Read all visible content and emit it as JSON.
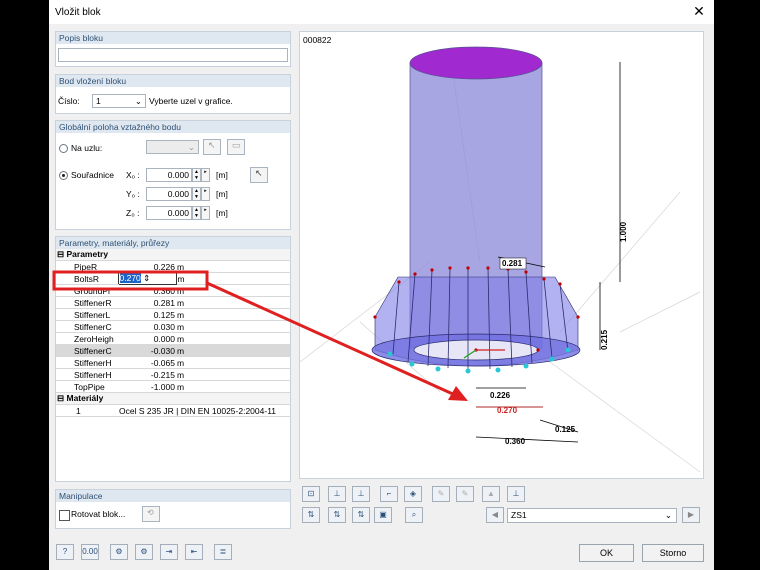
{
  "window": {
    "title": "Vložit blok"
  },
  "description_group": {
    "header": "Popis bloku",
    "value": ""
  },
  "insertion_group": {
    "header": "Bod vložení bloku",
    "number_label": "Číslo:",
    "number_value": "1",
    "hint": "Vyberte uzel v grafice."
  },
  "position_group": {
    "header": "Globální poloha vztažného bodu",
    "on_node_label": "Na uzlu:",
    "coords_label": "Souřadnice",
    "x_label": "X₀ :",
    "y_label": "Y₀ :",
    "z_label": "Z₀ :",
    "x_value": "0.000",
    "y_value": "0.000",
    "z_value": "0.000",
    "unit": "[m]"
  },
  "params_group": {
    "header": "Parametry, materiály, průřezy",
    "section_params": "Parametry",
    "section_materials": "Materiály",
    "rows": [
      {
        "name": "PipeR",
        "value": "0.226",
        "unit": "m"
      },
      {
        "name": "BoltsR",
        "value": "0.270",
        "unit": "m"
      },
      {
        "name": "GroundPl",
        "value": "0.360",
        "unit": "m"
      },
      {
        "name": "StiffenerR",
        "value": "0.281",
        "unit": "m"
      },
      {
        "name": "StiffenerL",
        "value": "0.125",
        "unit": "m"
      },
      {
        "name": "StiffenerC",
        "value": "0.030",
        "unit": "m"
      },
      {
        "name": "ZeroHeigh",
        "value": "0.000",
        "unit": "m"
      },
      {
        "name": "StiffenerC",
        "value": "-0.030",
        "unit": "m"
      },
      {
        "name": "StiffenerH",
        "value": "-0.065",
        "unit": "m"
      },
      {
        "name": "StiffenerH",
        "value": "-0.215",
        "unit": "m"
      },
      {
        "name": "TopPipe",
        "value": "-1.000",
        "unit": "m"
      }
    ],
    "material_no": "1",
    "material_name": "Ocel S 235 JR | DIN EN 10025-2:2004-11"
  },
  "manipulation_group": {
    "header": "Manipulace",
    "rotate_label": "Rotovat blok..."
  },
  "viewport": {
    "id_label": "000822",
    "dims": {
      "top": "0.281",
      "height": "1.000",
      "base": "0.215",
      "pipe": "0.226",
      "bolts": "0.270",
      "stiff": "0.125",
      "plate": "0.360"
    }
  },
  "load_case": {
    "selected": "ZS1"
  },
  "buttons": {
    "ok": "OK",
    "cancel": "Storno"
  },
  "colors": {
    "accent": "#e02020",
    "pipe": "#8a87d8",
    "pipe_top": "#a02ad0"
  }
}
